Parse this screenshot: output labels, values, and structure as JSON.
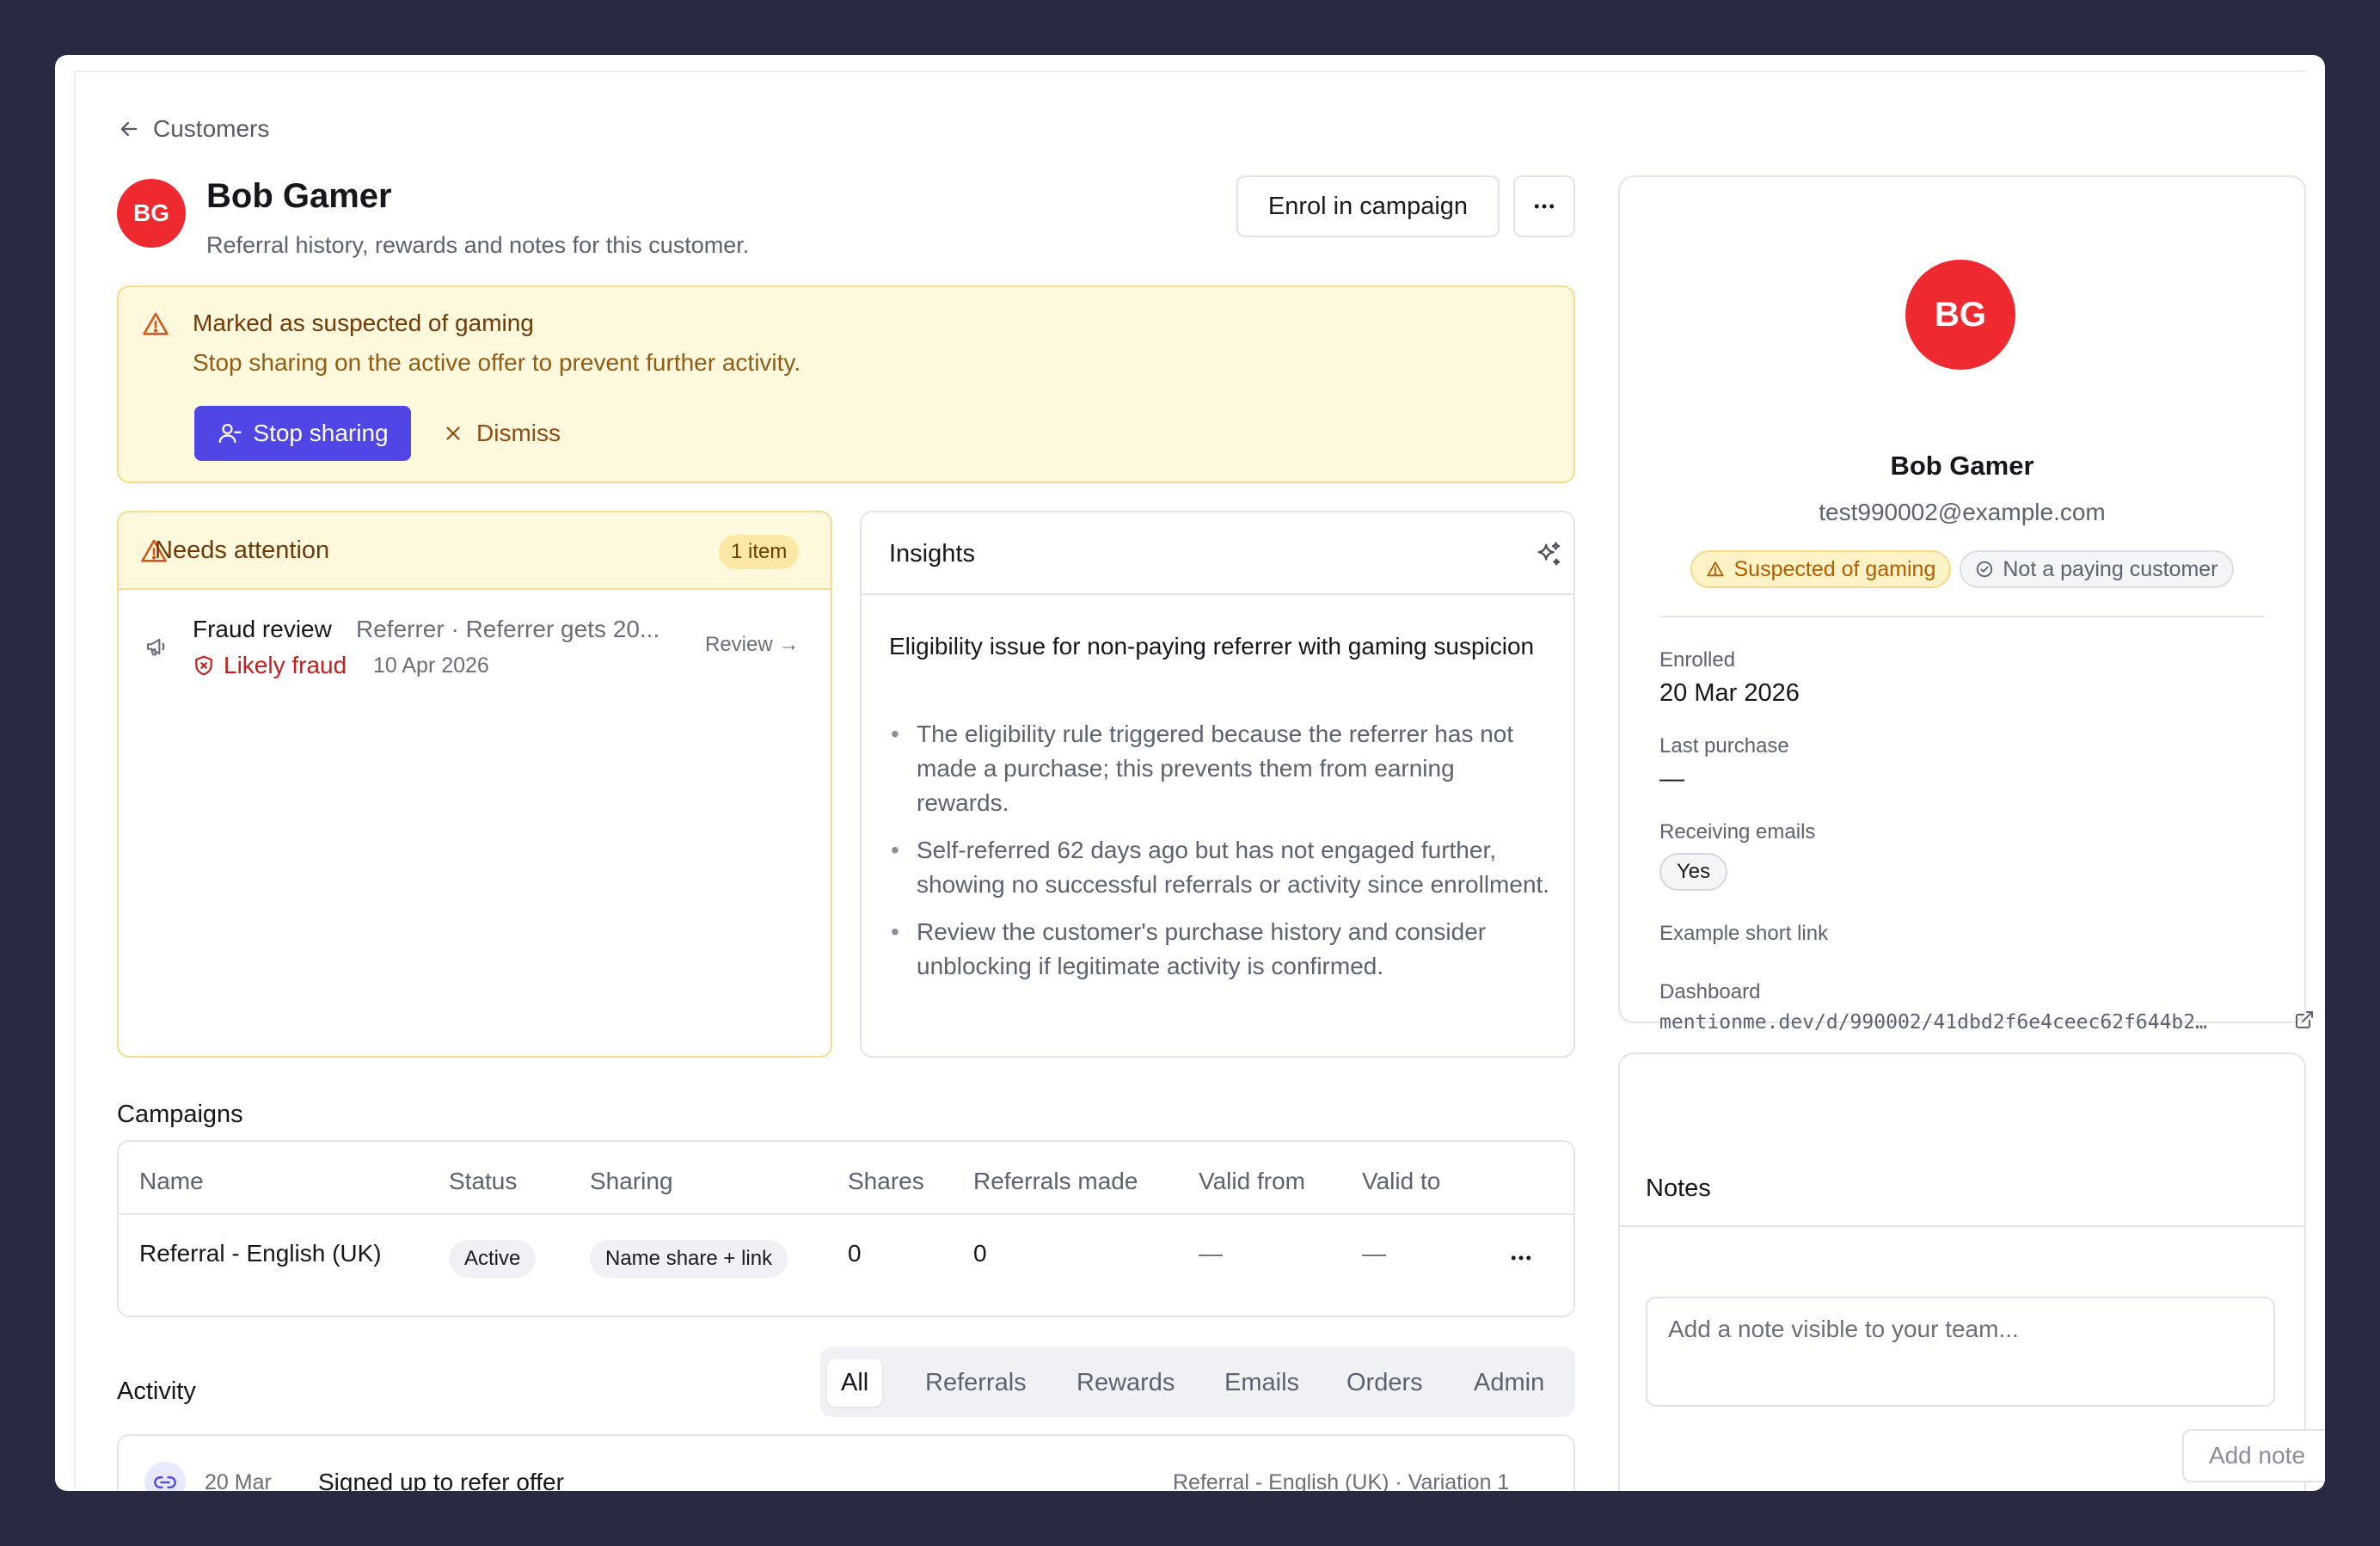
{
  "breadcrumb": {
    "label": "Customers",
    "icon": "arrow-left-icon"
  },
  "customer": {
    "initials": "BG",
    "name": "Bob Gamer",
    "subtitle": "Referral history, rewards and notes for this customer.",
    "email": "test990002@example.com",
    "avatar_color": "#ee2a30"
  },
  "header_actions": {
    "enrol_label": "Enrol in campaign",
    "more_icon": "more-horizontal-icon"
  },
  "banner": {
    "title": "Marked as suspected of gaming",
    "text": "Stop sharing on the active offer to prevent further activity.",
    "primary_label": "Stop sharing",
    "secondary_label": "Dismiss",
    "primary_color": "#4f46e5"
  },
  "attention": {
    "title": "Needs attention",
    "count_label": "1 item",
    "item": {
      "title": "Fraud review",
      "subtitle": "Referrer · Referrer gets 20...",
      "flag": "Likely fraud",
      "date": "10 Apr 2026",
      "action": "Review →"
    }
  },
  "insights": {
    "title": "Insights",
    "heading": "Eligibility issue for non-paying referrer with gaming suspicion",
    "bullets": [
      "The eligibility rule triggered because the referrer has not made a purchase; this prevents them from earning rewards.",
      "Self-referred 62 days ago but has not engaged further, showing no successful referrals or activity since enrollment.",
      "Review the customer's purchase history and consider unblocking if legitimate activity is confirmed."
    ]
  },
  "campaigns": {
    "title": "Campaigns",
    "columns": [
      "Name",
      "Status",
      "Sharing",
      "Shares",
      "Referrals made",
      "Valid from",
      "Valid to"
    ],
    "rows": [
      {
        "name": "Referral - English (UK)",
        "status": "Active",
        "sharing": "Name share + link",
        "shares": "0",
        "referrals": "0",
        "valid_from": "—",
        "valid_to": "—"
      }
    ]
  },
  "activity": {
    "title": "Activity",
    "tabs": [
      "All",
      "Referrals",
      "Rewards",
      "Emails",
      "Orders",
      "Admin"
    ],
    "active_tab": "All",
    "items": [
      {
        "date": "20 Mar",
        "title": "Signed up to refer offer",
        "meta": "Referral - English (UK) · Variation 1",
        "icon": "link-icon"
      }
    ]
  },
  "profile": {
    "badges": [
      {
        "label": "Suspected of gaming",
        "icon": "warning-triangle-icon"
      },
      {
        "label": "Not a paying customer",
        "icon": "check-circle-icon"
      }
    ],
    "fields": {
      "enrolled_label": "Enrolled",
      "enrolled_value": "20 Mar 2026",
      "last_purchase_label": "Last purchase",
      "last_purchase_value": "—",
      "emails_label": "Receiving emails",
      "emails_value": "Yes",
      "short_link_label": "Example short link",
      "dashboard_label": "Dashboard",
      "dashboard_value": "mentionme.dev/d/990002/41dbd2f6e4ceec62f644b2…"
    }
  },
  "notes": {
    "title": "Notes",
    "placeholder": "Add a note visible to your team...",
    "add_label": "Add note"
  }
}
